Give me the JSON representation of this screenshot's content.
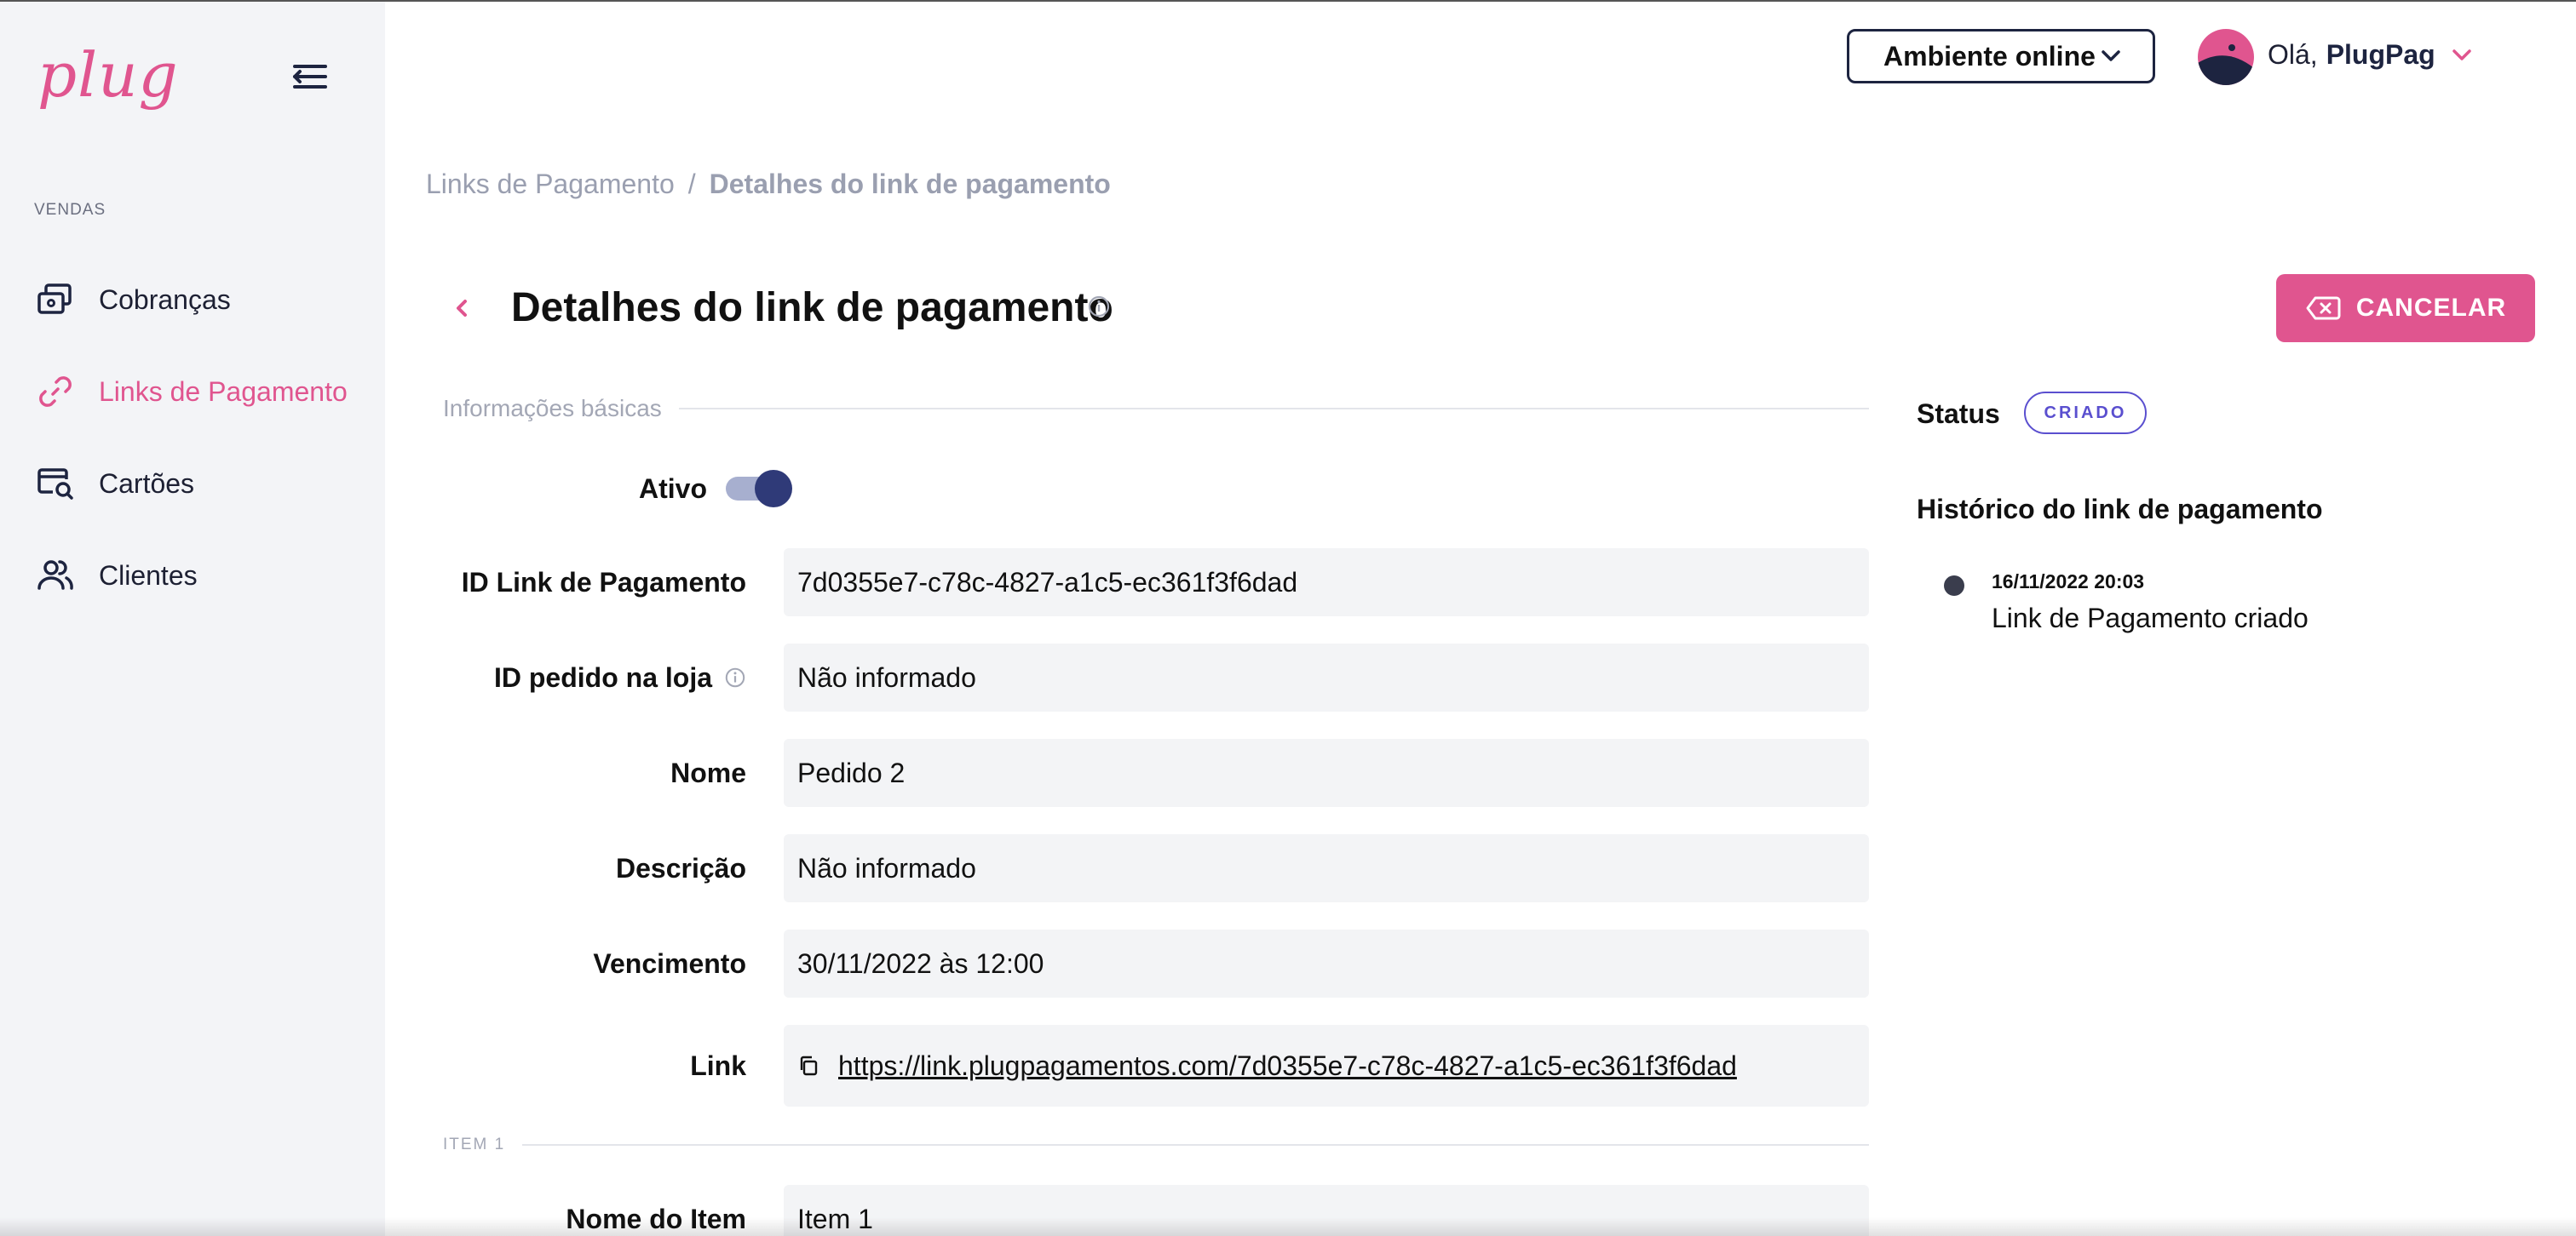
{
  "brand": {
    "logo_text": "plug",
    "accent": "#e0558f",
    "navy": "#1d2440"
  },
  "sidebar": {
    "section_label": "VENDAS",
    "items": [
      {
        "label": "Cobranças",
        "icon": "cash-icon",
        "active": false
      },
      {
        "label": "Links de Pagamento",
        "icon": "link-icon",
        "active": true
      },
      {
        "label": "Cartões",
        "icon": "card-search-icon",
        "active": false
      },
      {
        "label": "Clientes",
        "icon": "users-icon",
        "active": false
      }
    ]
  },
  "header": {
    "environment": "Ambiente online",
    "greeting": "Olá,",
    "user_name": "PlugPag"
  },
  "breadcrumb": {
    "parent": "Links de Pagamento",
    "separator": "/",
    "current": "Detalhes do link de pagamento"
  },
  "page": {
    "title": "Detalhes do link de pagamento",
    "cancel_label": "CANCELAR"
  },
  "basic_info": {
    "section_title": "Informações básicas",
    "active_label": "Ativo",
    "active": true,
    "fields": {
      "id_link": {
        "label": "ID Link de Pagamento",
        "value": "7d0355e7-c78c-4827-a1c5-ec361f3f6dad"
      },
      "id_pedido": {
        "label": "ID pedido na loja",
        "value": "Não informado"
      },
      "nome": {
        "label": "Nome",
        "value": "Pedido 2"
      },
      "descricao": {
        "label": "Descrição",
        "value": "Não informado"
      },
      "vencimento": {
        "label": "Vencimento",
        "value": "30/11/2022 às 12:00"
      },
      "link": {
        "label": "Link",
        "value": "https://link.plugpagamentos.com/7d0355e7-c78c-4827-a1c5-ec361f3f6dad"
      }
    }
  },
  "item_section": {
    "title": "ITEM 1",
    "fields": {
      "nome_item": {
        "label": "Nome do Item",
        "value": "Item 1"
      }
    }
  },
  "status": {
    "label": "Status",
    "badge": "CRIADO",
    "badge_color": "#5a4fcf"
  },
  "history": {
    "title": "Histórico do link de pagamento",
    "entries": [
      {
        "date": "16/11/2022 20:03",
        "text": "Link de Pagamento criado"
      }
    ]
  }
}
